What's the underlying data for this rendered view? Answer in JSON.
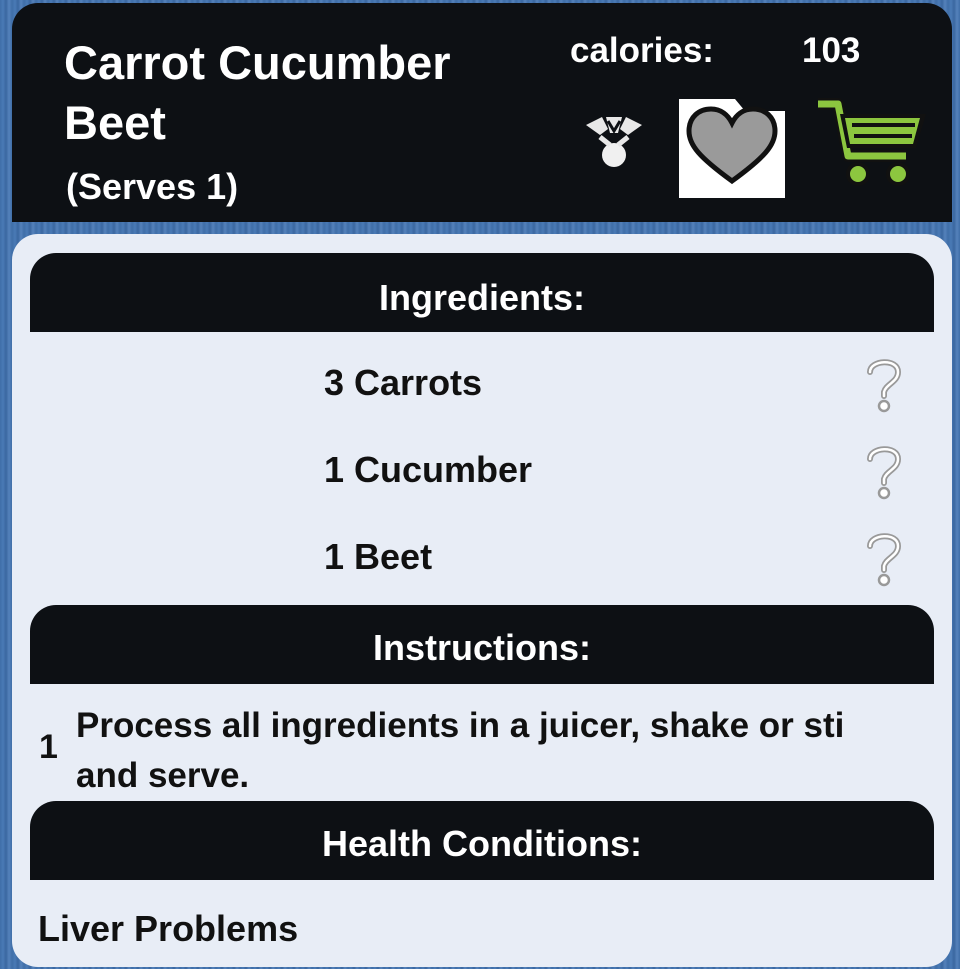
{
  "recipe": {
    "title_line1": "Carrot Cucumber",
    "title_line2": "Beet",
    "serves": "(Serves 1)",
    "calories_label": "calories:",
    "calories_value": "103"
  },
  "actions": {
    "share_icon": "share-icon",
    "favorite_icon": "heart-folder-icon",
    "cart_icon": "shopping-cart-icon",
    "cart_color": "#8cc63f"
  },
  "sections": {
    "ingredients_title": "Ingredients:",
    "instructions_title": "Instructions:",
    "health_title": "Health Conditions:"
  },
  "ingredients": [
    {
      "text": "3 Carrots"
    },
    {
      "text": "1 Cucumber"
    },
    {
      "text": "1 Beet"
    }
  ],
  "instructions": [
    {
      "number": "1",
      "line1": "Process all ingredients in a juicer, shake or sti",
      "line2": "and serve."
    }
  ],
  "health_conditions": [
    "Liver Problems"
  ]
}
